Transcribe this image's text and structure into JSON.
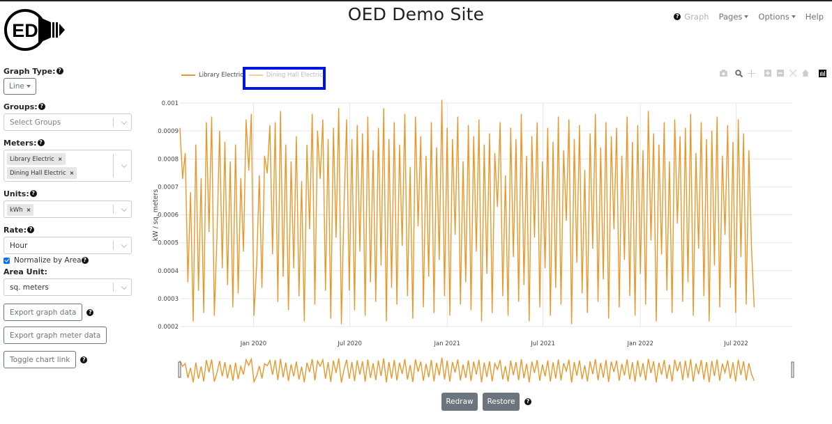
{
  "header": {
    "logo_text": "ED",
    "title": "OED Demo Site",
    "nav": {
      "help_icon": "question-circle-icon",
      "graph": "Graph",
      "pages": "Pages",
      "options": "Options",
      "help": "Help"
    }
  },
  "sidebar": {
    "graph_type": {
      "label": "Graph Type:",
      "value": "Line"
    },
    "groups": {
      "label": "Groups:",
      "placeholder": "Select Groups"
    },
    "meters": {
      "label": "Meters:",
      "selected": [
        "Library Electric",
        "Dining Hall Electric"
      ]
    },
    "units": {
      "label": "Units:",
      "selected": [
        "kWh"
      ]
    },
    "rate": {
      "label": "Rate:",
      "value": "Hour"
    },
    "normalize": {
      "label": "Normalize by Area",
      "checked": true
    },
    "area_unit": {
      "label": "Area Unit:",
      "value": "sq. meters"
    },
    "buttons": {
      "export_graph_data": "Export graph data",
      "export_meter_data": "Export graph meter data",
      "toggle_chart_link": "Toggle chart link"
    }
  },
  "modebar": [
    "camera-icon",
    "zoom-icon",
    "pan-icon",
    "zoom-in-icon",
    "zoom-out-icon",
    "autoscale-icon",
    "reset-axes-icon",
    "plotly-logo-icon"
  ],
  "controls": {
    "redraw": "Redraw",
    "restore": "Restore"
  },
  "colors": {
    "library_electric": "#e8982b",
    "dining_hall_electric": "#f2d28a",
    "grid": "#e6e6e6",
    "highlight_box": "#0016e0"
  },
  "chart_data": {
    "type": "line",
    "title": "",
    "xlabel": "",
    "ylabel": "kW / sq. meters",
    "ylim": [
      0.0002,
      0.001
    ],
    "xlim": [
      "2019-08-15",
      "2022-10-15"
    ],
    "yticks": [
      "0.0002",
      "0.0003",
      "0.0004",
      "0.0005",
      "0.0006",
      "0.0007",
      "0.0008",
      "0.0009",
      "0.001"
    ],
    "xticks": [
      {
        "date": "2020-01-01",
        "label": "Jan 2020"
      },
      {
        "date": "2020-07-01",
        "label": "Jul 2020"
      },
      {
        "date": "2021-01-01",
        "label": "Jan 2021"
      },
      {
        "date": "2021-07-01",
        "label": "Jul 2021"
      },
      {
        "date": "2022-01-01",
        "label": "Jan 2022"
      },
      {
        "date": "2022-07-01",
        "label": "Jul 2022"
      }
    ],
    "grid": true,
    "legend": "top-left",
    "series": [
      {
        "name": "Library Electric",
        "visible": true,
        "start": "2019-08-15",
        "step_days": 5,
        "values": [
          0.00091,
          0.00073,
          0.00082,
          0.00036,
          0.00068,
          0.00022,
          0.00085,
          0.00033,
          0.00073,
          0.00025,
          0.00093,
          0.00054,
          0.00095,
          0.00024,
          0.00052,
          0.0009,
          0.00041,
          0.00086,
          0.00035,
          0.00079,
          0.00027,
          0.00085,
          0.00032,
          0.00073,
          0.00047,
          0.00094,
          0.00076,
          0.00096,
          0.00024,
          0.00042,
          0.00074,
          0.00034,
          0.00081,
          0.00075,
          0.00092,
          0.00046,
          0.00093,
          0.00029,
          0.00097,
          0.00038,
          0.00085,
          0.00026,
          0.00079,
          0.00041,
          0.00088,
          0.00031,
          0.00072,
          0.00022,
          0.00085,
          0.00055,
          0.00096,
          0.00028,
          0.0009,
          0.00073,
          0.00094,
          0.00033,
          0.00087,
          0.00023,
          0.00091,
          0.00052,
          0.00098,
          0.00021,
          0.00062,
          0.00094,
          0.00033,
          0.00087,
          0.00026,
          0.00092,
          0.00047,
          0.00089,
          0.00024,
          0.00095,
          0.00036,
          0.00083,
          0.00029,
          0.00091,
          0.00042,
          0.00098,
          0.00022,
          0.00087,
          0.00034,
          0.00093,
          0.00028,
          0.00085,
          0.00049,
          0.00096,
          0.00031,
          0.00077,
          0.00023,
          0.00095,
          0.00056,
          0.00088,
          0.00027,
          0.00081,
          0.00038,
          0.00093,
          0.00025,
          0.00084,
          0.00044,
          0.00101,
          0.00031,
          0.00091,
          0.00024,
          0.00087,
          0.00053,
          0.00095,
          0.00028,
          0.00079,
          0.00036,
          0.00092,
          0.00026,
          0.00088,
          0.00047,
          0.00094,
          0.00022,
          0.00085,
          0.00039,
          0.00089,
          0.00025,
          0.00082,
          0.00063,
          0.00093,
          0.00031,
          0.00074,
          0.00024,
          0.00091,
          0.00045,
          0.00087,
          0.00029,
          0.00096,
          0.00035,
          0.00081,
          0.00022,
          0.00088,
          0.00052,
          0.00093,
          0.00027,
          0.00079,
          0.00041,
          0.00091,
          0.00024,
          0.00086,
          0.00034,
          0.00095,
          0.00028,
          0.00083,
          0.00058,
          0.00094,
          0.00021,
          0.00087,
          0.00043,
          0.00092,
          0.00032,
          0.00076,
          0.00025,
          0.00089,
          0.00048,
          0.00096,
          0.00029,
          0.00084,
          0.00037,
          0.00093,
          0.00023,
          0.00088,
          0.00055,
          0.00091,
          0.00027,
          0.00081,
          0.00044,
          0.00095,
          0.00031,
          0.00086,
          0.00024,
          0.00092,
          0.00039,
          0.00083,
          0.00028,
          0.00097,
          0.00051,
          0.00089,
          0.00022,
          0.00085,
          0.00046,
          0.00093,
          0.00033,
          0.00079,
          0.00025,
          0.00094,
          0.00057,
          0.00088,
          0.00029,
          0.00091,
          0.00036,
          0.00096,
          0.00024,
          0.00082,
          0.00048,
          0.00093,
          0.00031,
          0.00087,
          0.00022,
          0.0009,
          0.00042,
          0.00095,
          0.00027,
          0.00081,
          0.00053,
          0.00092,
          0.00034,
          0.00086,
          0.00025,
          0.00094,
          0.00045,
          0.00089,
          0.00028,
          0.00083,
          0.00048,
          0.00027
        ]
      },
      {
        "name": "Dining Hall Electric",
        "visible": "legendonly",
        "values": []
      }
    ]
  }
}
